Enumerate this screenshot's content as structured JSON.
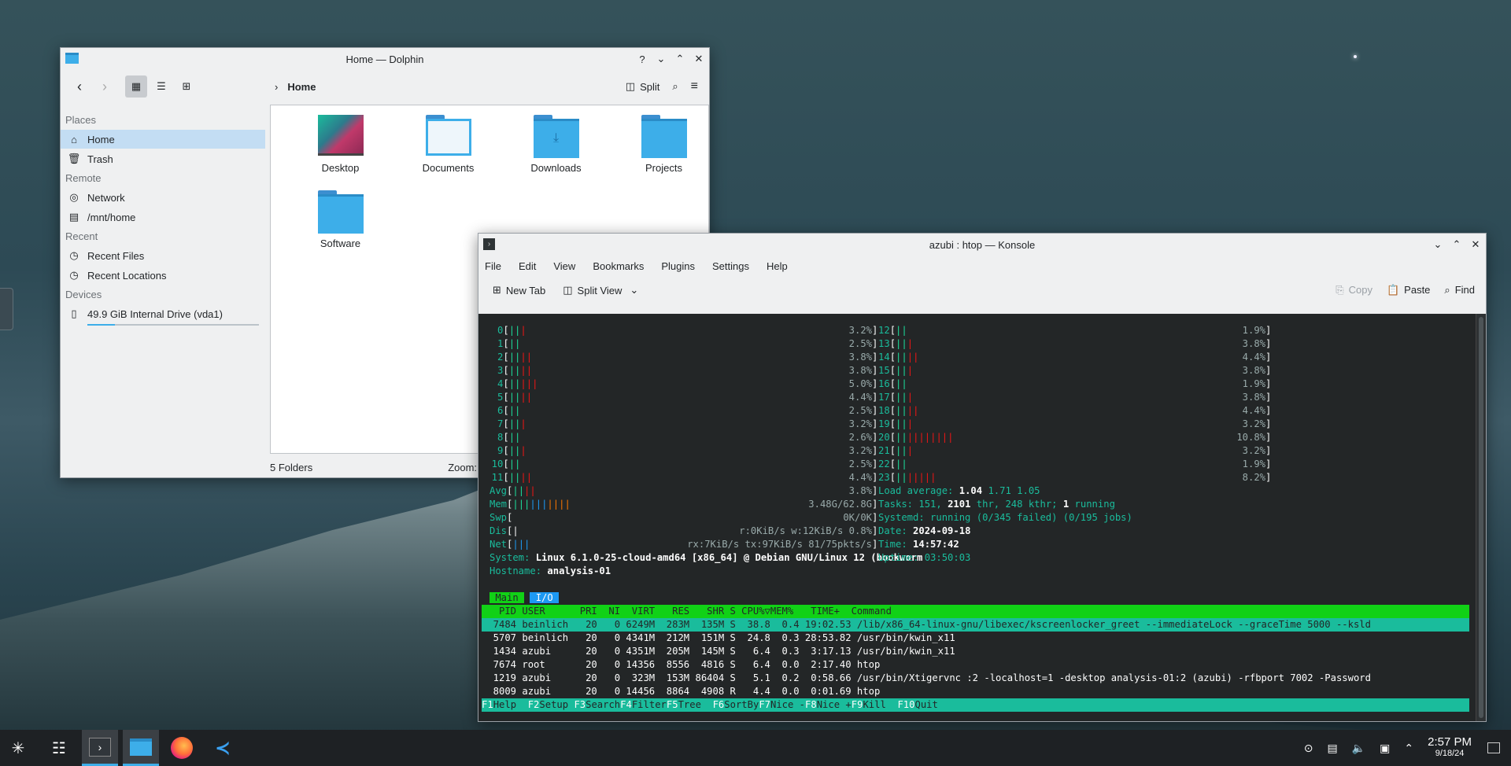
{
  "dolphin": {
    "title": "Home — Dolphin",
    "breadcrumb": "Home",
    "split_label": "Split",
    "sidebar": {
      "places_header": "Places",
      "places": [
        "Home",
        "Trash"
      ],
      "remote_header": "Remote",
      "remote": [
        "Network",
        "/mnt/home"
      ],
      "recent_header": "Recent",
      "recent": [
        "Recent Files",
        "Recent Locations"
      ],
      "devices_header": "Devices",
      "device": "49.9 GiB Internal Drive (vda1)",
      "device_usage_fraction": 0.16
    },
    "files": [
      "Desktop",
      "Documents",
      "Downloads",
      "Projects",
      "Software"
    ],
    "status": "5 Folders",
    "zoom_label": "Zoom:"
  },
  "konsole": {
    "title": "azubi : htop — Konsole",
    "menu": [
      "File",
      "Edit",
      "View",
      "Bookmarks",
      "Plugins",
      "Settings",
      "Help"
    ],
    "toolbar": {
      "new_tab": "New Tab",
      "split_view": "Split View",
      "copy": "Copy",
      "paste": "Paste",
      "find": "Find"
    }
  },
  "htop": {
    "cpus_left": [
      {
        "id": "0",
        "bars": "|||",
        "pct": "3.2%"
      },
      {
        "id": "1",
        "bars": "||",
        "pct": "2.5%"
      },
      {
        "id": "2",
        "bars": "||||",
        "pct": "3.8%"
      },
      {
        "id": "3",
        "bars": "||||",
        "pct": "3.8%"
      },
      {
        "id": "4",
        "bars": "|||||",
        "pct": "5.0%"
      },
      {
        "id": "5",
        "bars": "||||",
        "pct": "4.4%"
      },
      {
        "id": "6",
        "bars": "||",
        "pct": "2.5%"
      },
      {
        "id": "7",
        "bars": "|||",
        "pct": "3.2%"
      },
      {
        "id": "8",
        "bars": "||",
        "pct": "2.6%"
      },
      {
        "id": "9",
        "bars": "|||",
        "pct": "3.2%"
      },
      {
        "id": "10",
        "bars": "||",
        "pct": "2.5%"
      },
      {
        "id": "11",
        "bars": "||||",
        "pct": "4.4%"
      }
    ],
    "cpus_right": [
      {
        "id": "12",
        "bars": "||",
        "pct": "1.9%"
      },
      {
        "id": "13",
        "bars": "|||",
        "pct": "3.8%"
      },
      {
        "id": "14",
        "bars": "||||",
        "pct": "4.4%"
      },
      {
        "id": "15",
        "bars": "|||",
        "pct": "3.8%"
      },
      {
        "id": "16",
        "bars": "||",
        "pct": "1.9%"
      },
      {
        "id": "17",
        "bars": "|||",
        "pct": "3.8%"
      },
      {
        "id": "18",
        "bars": "||||",
        "pct": "4.4%"
      },
      {
        "id": "19",
        "bars": "|||",
        "pct": "3.2%"
      },
      {
        "id": "20",
        "bars": "||||||||||",
        "pct": "10.8%"
      },
      {
        "id": "21",
        "bars": "|||",
        "pct": "3.2%"
      },
      {
        "id": "22",
        "bars": "||",
        "pct": "1.9%"
      },
      {
        "id": "23",
        "bars": "|||||||",
        "pct": "8.2%"
      }
    ],
    "meters": {
      "avg": {
        "label": "Avg",
        "bars": "||||",
        "value": "3.8%"
      },
      "mem": {
        "label": "Mem",
        "bars": "||||||||||",
        "value": "3.48G/62.8G"
      },
      "swp": {
        "label": "Swp",
        "bars": "",
        "value": "0K/0K"
      },
      "dis": {
        "label": "Dis",
        "bars": "|",
        "value": "r:0KiB/s w:12KiB/s 0.8%"
      },
      "net": {
        "label": "Net",
        "bars": "|||",
        "value": "rx:7KiB/s tx:97KiB/s 81/75pkts/s"
      }
    },
    "system_label": "System:",
    "system": "Linux 6.1.0-25-cloud-amd64 [x86_64] @ Debian GNU/Linux 12 (bookworm",
    "hostname_label": "Hostname:",
    "hostname": "analysis-01",
    "load_label": "Load average:",
    "load": [
      "1.04",
      "1.71",
      "1.05"
    ],
    "tasks_label": "Tasks:",
    "tasks": {
      "tasks": "151",
      "thr": "2101",
      "kthr": "248",
      "running": "1"
    },
    "systemd_label": "Systemd:",
    "systemd": "running (0/345 failed) (0/195 jobs)",
    "date_label": "Date:",
    "date": "2024-09-18",
    "time_label": "Time:",
    "time": "14:57:42",
    "uptime_label": "Uptime:",
    "uptime": "03:50:03",
    "tabs": [
      "Main",
      "I/O"
    ],
    "columns": [
      "PID",
      "USER",
      "PRI",
      "NI",
      "VIRT",
      "RES",
      "SHR",
      "S",
      "CPU%▽",
      "MEM%",
      "TIME+",
      "Command"
    ],
    "processes": [
      [
        "7484",
        "beinlich",
        "20",
        "0",
        "6249M",
        "283M",
        "135M",
        "S",
        "38.8",
        "0.4",
        "19:02.53",
        "/lib/x86_64-linux-gnu/libexec/kscreenlocker_greet --immediateLock --graceTime 5000 --ksld"
      ],
      [
        "5707",
        "beinlich",
        "20",
        "0",
        "4341M",
        "212M",
        "151M",
        "S",
        "24.8",
        "0.3",
        "28:53.82",
        "/usr/bin/kwin_x11"
      ],
      [
        "1434",
        "azubi",
        "20",
        "0",
        "4351M",
        "205M",
        "145M",
        "S",
        "6.4",
        "0.3",
        "3:17.13",
        "/usr/bin/kwin_x11"
      ],
      [
        "7674",
        "root",
        "20",
        "0",
        "14356",
        "8556",
        "4816",
        "S",
        "6.4",
        "0.0",
        "2:17.40",
        "htop"
      ],
      [
        "1219",
        "azubi",
        "20",
        "0",
        "323M",
        "153M",
        "86404",
        "S",
        "5.1",
        "0.2",
        "0:58.66",
        "/usr/bin/Xtigervnc :2 -localhost=1 -desktop analysis-01:2 (azubi) -rfbport 7002 -Password"
      ],
      [
        "8009",
        "azubi",
        "20",
        "0",
        "14456",
        "8864",
        "4908",
        "R",
        "4.4",
        "0.0",
        "0:01.69",
        "htop"
      ]
    ],
    "fkeys": [
      {
        "k": "F1",
        "l": "Help"
      },
      {
        "k": "F2",
        "l": "Setup"
      },
      {
        "k": "F3",
        "l": "Search"
      },
      {
        "k": "F4",
        "l": "Filter"
      },
      {
        "k": "F5",
        "l": "Tree"
      },
      {
        "k": "F6",
        "l": "SortBy"
      },
      {
        "k": "F7",
        "l": "Nice -"
      },
      {
        "k": "F8",
        "l": "Nice +"
      },
      {
        "k": "F9",
        "l": "Kill"
      },
      {
        "k": "F10",
        "l": "Quit"
      }
    ]
  },
  "taskbar": {
    "time": "2:57 PM",
    "date": "9/18/24",
    "apps": [
      "application-launcher-icon",
      "system-settings-icon",
      "konsole-icon",
      "dolphin-icon",
      "firefox-icon",
      "vscode-icon"
    ]
  },
  "colors": {
    "accent": "#3daee9",
    "htop_green": "#11d116",
    "htop_teal": "#1abc9c"
  }
}
